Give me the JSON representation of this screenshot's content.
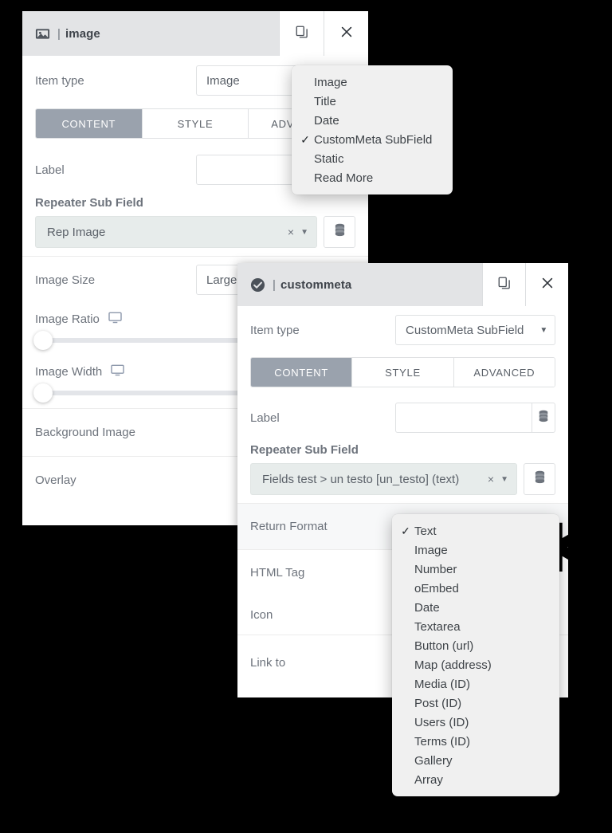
{
  "canvas": {
    "background": "#000000"
  },
  "panel_image": {
    "header": {
      "icon": "image-icon",
      "separator": "|",
      "title": "image",
      "duplicate_label": "duplicate-icon",
      "close_label": "close-icon"
    },
    "item_type": {
      "label": "Item type",
      "value": "Image"
    },
    "tabs": [
      {
        "label": "CONTENT",
        "active": true
      },
      {
        "label": "STYLE",
        "active": false
      },
      {
        "label": "ADVANCED",
        "active": false
      }
    ],
    "label_field": {
      "label": "Label",
      "value": "",
      "placeholder": ""
    },
    "repeater_sub_field": {
      "section_label": "Repeater Sub Field",
      "value": "Rep Image",
      "clear": "×",
      "caret": "▼"
    },
    "image_size": {
      "label": "Image Size",
      "value": "Large -"
    },
    "image_ratio": {
      "label": "Image Ratio",
      "device_icon": "desktop-icon"
    },
    "image_width": {
      "label": "Image Width",
      "device_icon": "desktop-icon"
    },
    "background_image": {
      "label": "Background Image"
    },
    "overlay": {
      "label": "Overlay"
    }
  },
  "menu_item_type": {
    "items": [
      {
        "label": "Image",
        "checked": false
      },
      {
        "label": "Title",
        "checked": false
      },
      {
        "label": "Date",
        "checked": false
      },
      {
        "label": "CustomMeta SubField",
        "checked": true
      },
      {
        "label": "Static",
        "checked": false
      },
      {
        "label": "Read More",
        "checked": false
      }
    ],
    "check_glyph": "✓"
  },
  "panel_custommeta": {
    "header": {
      "icon": "check-circle-icon",
      "separator": "|",
      "title": "custommeta",
      "duplicate_label": "duplicate-icon",
      "close_label": "close-icon"
    },
    "item_type": {
      "label": "Item type",
      "value": "CustomMeta SubField",
      "caret": "▼"
    },
    "tabs": [
      {
        "label": "CONTENT",
        "active": true
      },
      {
        "label": "STYLE",
        "active": false
      },
      {
        "label": "ADVANCED",
        "active": false
      }
    ],
    "label_field": {
      "label": "Label",
      "value": "",
      "placeholder": ""
    },
    "repeater_sub_field": {
      "section_label": "Repeater Sub Field",
      "value": "Fields test > un testo [un_testo] (text)",
      "clear": "×",
      "caret": "▼"
    },
    "return_format": {
      "label": "Return Format"
    },
    "html_tag": {
      "label": "HTML Tag"
    },
    "icon_row": {
      "label": "Icon"
    },
    "link_to": {
      "label": "Link to"
    }
  },
  "menu_return_format": {
    "items": [
      {
        "label": "Text",
        "checked": true
      },
      {
        "label": "Image",
        "checked": false
      },
      {
        "label": "Number",
        "checked": false
      },
      {
        "label": "oEmbed",
        "checked": false
      },
      {
        "label": "Date",
        "checked": false
      },
      {
        "label": "Textarea",
        "checked": false
      },
      {
        "label": "Button (url)",
        "checked": false
      },
      {
        "label": "Map (address)",
        "checked": false
      },
      {
        "label": "Media (ID)",
        "checked": false
      },
      {
        "label": "Post (ID)",
        "checked": false
      },
      {
        "label": "Users (ID)",
        "checked": false
      },
      {
        "label": "Terms (ID)",
        "checked": false
      },
      {
        "label": "Gallery",
        "checked": false
      },
      {
        "label": "Array",
        "checked": false
      }
    ],
    "check_glyph": "✓"
  },
  "decoration": {
    "asterisk": "✱"
  },
  "colors": {
    "panel_header_bg": "#e3e4e6",
    "tab_active_bg": "#9aa2ad",
    "field_pill_bg": "#e7eceb",
    "menu_bg": "#f0f0f0",
    "text": "#6d737c",
    "background": "#000000"
  }
}
